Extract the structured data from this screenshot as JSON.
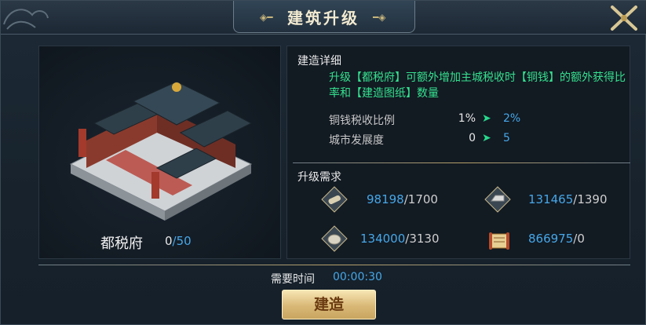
{
  "window": {
    "title": "建筑升级"
  },
  "building": {
    "name": "都税府",
    "count": "0",
    "max": "50"
  },
  "details": {
    "header": "建造详细",
    "description": "升级【都税府】可额外增加主城税收时【铜钱】的额外获得比率和【建造图纸】数量",
    "stats": [
      {
        "label": "铜钱税收比例",
        "from": "1%",
        "to": "2%"
      },
      {
        "label": "城市发展度",
        "from": "0",
        "to": "5"
      }
    ]
  },
  "requirements": {
    "header": "升级需求",
    "items": [
      {
        "icon": "wood-icon",
        "have": "98198",
        "need": "/1700"
      },
      {
        "icon": "iron-ingot-icon",
        "have": "131465",
        "need": "/1390"
      },
      {
        "icon": "stone-icon",
        "have": "134000",
        "need": "/3130"
      },
      {
        "icon": "blueprint-scroll-icon",
        "have": "866975",
        "need": "/0"
      }
    ]
  },
  "time": {
    "label": "需要时间",
    "value": "00:00:30"
  },
  "actions": {
    "build_label": "建造"
  }
}
